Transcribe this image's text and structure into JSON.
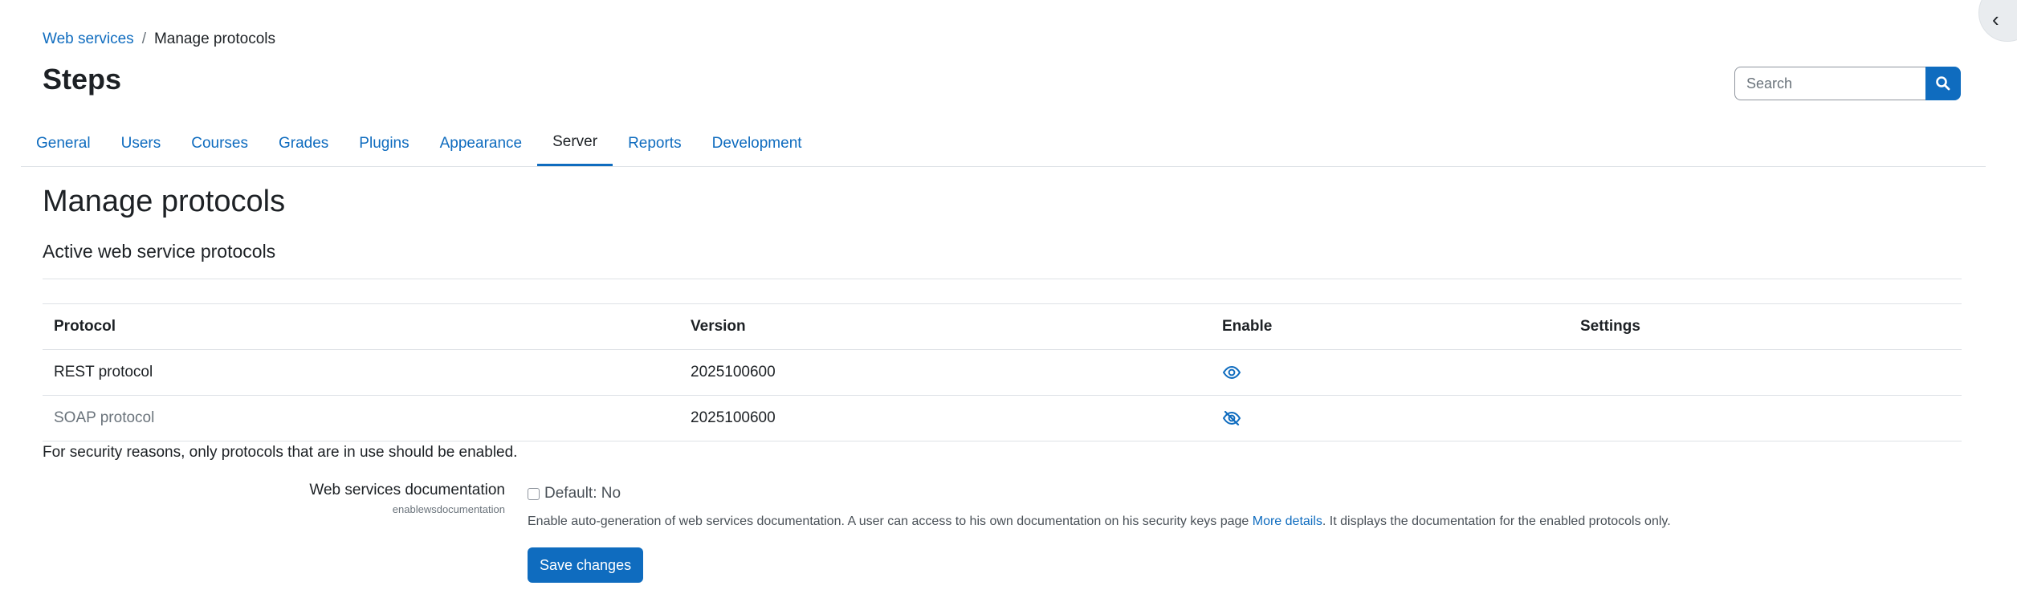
{
  "breadcrumb": {
    "parent": "Web services",
    "separator": "/",
    "current": "Manage protocols"
  },
  "page_title": "Steps",
  "search": {
    "placeholder": "Search",
    "icon": "search-icon"
  },
  "tabs": [
    {
      "label": "General",
      "active": false
    },
    {
      "label": "Users",
      "active": false
    },
    {
      "label": "Courses",
      "active": false
    },
    {
      "label": "Grades",
      "active": false
    },
    {
      "label": "Plugins",
      "active": false
    },
    {
      "label": "Appearance",
      "active": false
    },
    {
      "label": "Server",
      "active": true
    },
    {
      "label": "Reports",
      "active": false
    },
    {
      "label": "Development",
      "active": false
    }
  ],
  "main": {
    "heading": "Manage protocols",
    "subheading": "Active web service protocols",
    "table": {
      "headers": {
        "protocol": "Protocol",
        "version": "Version",
        "enable": "Enable",
        "settings": "Settings"
      },
      "rows": [
        {
          "protocol": "REST protocol",
          "version": "2025100600",
          "enabled": true,
          "enable_icon": "eye-icon"
        },
        {
          "protocol": "SOAP protocol",
          "version": "2025100600",
          "enabled": false,
          "enable_icon": "eye-slash-icon"
        }
      ]
    },
    "security_note": "For security reasons, only protocols that are in use should be enabled.",
    "setting": {
      "label": "Web services documentation",
      "key": "enablewsdocumentation",
      "default_text": "Default: No",
      "checked": false,
      "description_before": "Enable auto-generation of web services documentation. A user can access to his own documentation on his security keys page",
      "description_link": "More details",
      "description_after": ". It displays the documentation for the enabled protocols only."
    },
    "save_label": "Save changes"
  },
  "colors": {
    "link": "#0f6cbf",
    "primary": "#0f6cbf",
    "text": "#1d2125",
    "muted": "#6a737b",
    "border": "#dee2e6"
  }
}
